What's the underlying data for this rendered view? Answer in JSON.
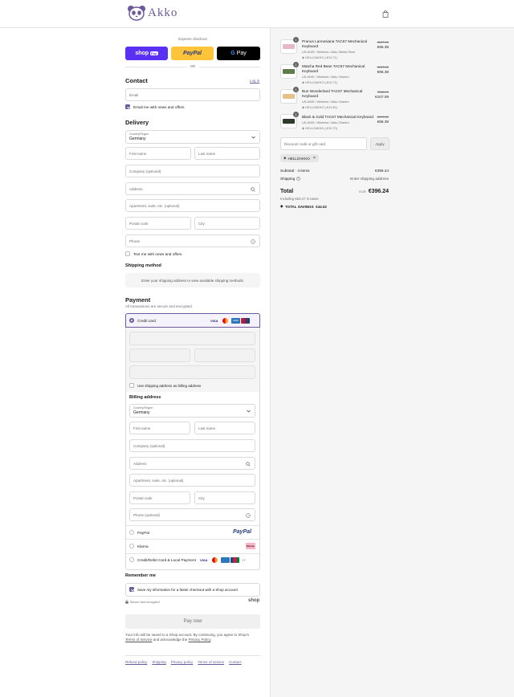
{
  "header": {
    "logo_text": "Akko",
    "cart_icon": "bag-icon"
  },
  "express": {
    "title": "Express checkout",
    "shop_pay_label": "shop",
    "shop_pay_badge": "Pay",
    "paypal_label": "PayPal",
    "gpay_label": "Pay",
    "or": "OR",
    "colors": {
      "shop": "#5a31f4",
      "paypal": "#ffc439",
      "gpay": "#000000"
    }
  },
  "contact": {
    "title": "Contact",
    "login": "Log in",
    "email_placeholder": "Email",
    "email_news_label": "Email me with news and offers",
    "email_news_checked": true
  },
  "delivery": {
    "title": "Delivery",
    "country_label": "Country/Region",
    "country_value": "Germany",
    "first_name": "First name",
    "last_name": "Last name",
    "company": "Company (optional)",
    "address": "Address",
    "apartment": "Apartment, suite, etc. (optional)",
    "postal": "Postal code",
    "city": "City",
    "phone": "Phone",
    "text_news_label": "Text me with news and offers"
  },
  "shipping": {
    "title": "Shipping method",
    "message": "Enter your shipping address to view available shipping methods."
  },
  "payment": {
    "title": "Payment",
    "subtitle": "All transactions are secure and encrypted.",
    "credit_card_label": "Credit card",
    "billing_same_label": "Use shipping address as billing address",
    "billing_title": "Billing address",
    "billing_country_label": "Country/Region",
    "billing_country_value": "Germany",
    "billing_first": "First name",
    "billing_last": "Last name",
    "billing_company": "Company (optional)",
    "billing_address": "Address",
    "billing_apartment": "Apartment, suite, etc. (optional)",
    "billing_postal": "Postal code",
    "billing_city": "City",
    "billing_phone": "Phone (optional)",
    "paypal_label": "PayPal",
    "paypal_logo": "PayPal",
    "klarna_label": "Klarna",
    "klarna_logo": "Klarna.",
    "local_label": "Credit/Debit Card & Local Payment",
    "more_cards": "+7",
    "card_visa": "VISA",
    "card_amex": "AMEX"
  },
  "remember": {
    "title": "Remember me",
    "save_label": "Save my information for a faster checkout with a Shop account",
    "secure": "Secure and encrypted",
    "shop_logo": "shop"
  },
  "pay_now": "Pay now",
  "legal": {
    "text1": "Your info will be saved to a Shop account. By continuing, you agree to Shop's",
    "tos": "Terms of Service",
    "text2": "and acknowledge the",
    "privacy": "Privacy Policy",
    "end": "."
  },
  "footer": {
    "links": [
      "Refund policy",
      "Shipping",
      "Privacy policy",
      "Terms of service",
      "Contact"
    ]
  },
  "order": {
    "items": [
      {
        "qty": "1",
        "title": "Prunus Lannesiana TAC67 Mechanical Keyboard",
        "variant": "US-ANSI / Wireless / Akko Stellar Rose",
        "discount": "HELLOAKKO (-€10.71)",
        "old_price": "€107.09",
        "price": "€96.38",
        "color": "#e8b7c4"
      },
      {
        "qty": "1",
        "title": "Matcha Red Bean TAC67 Mechanical Keyboard",
        "variant": "US-ANSI / Wireless / Akko Cilantro",
        "discount": "HELLOAKKO (-€10.71)",
        "old_price": "€107.09",
        "price": "€96.38",
        "color": "#5e7b4a"
      },
      {
        "qty": "1",
        "title": "Bun Wonderland TAC67 Mechanical Keyboard",
        "variant": "US-ANSI / Wireless / Akko Cilantro",
        "discount": "HELLOAKKO (-€11.90)",
        "old_price": "€118.99",
        "price": "€107.09",
        "color": "#e6c28a"
      },
      {
        "qty": "1",
        "title": "Black & Gold TAC67 Mechanical Keyboard",
        "variant": "US-ANSI / Wireless / Akko Cilantro",
        "discount": "HELLOAKKO (-€10.70)",
        "old_price": "€107.09",
        "price": "€96.39",
        "color": "#2f3a2a"
      }
    ],
    "discount_placeholder": "Discount code or gift card",
    "apply": "Apply",
    "applied_code": "HELLOAKKO",
    "subtotal_label": "Subtotal · 4 items",
    "subtotal_value": "€396.24",
    "shipping_label": "Shipping",
    "shipping_value": "Enter shipping address",
    "total_label": "Total",
    "currency": "EUR",
    "total_value": "€396.24",
    "taxes": "Including €63.27 in taxes",
    "savings_label": "TOTAL SAVINGS",
    "savings_value": "€44.02"
  }
}
